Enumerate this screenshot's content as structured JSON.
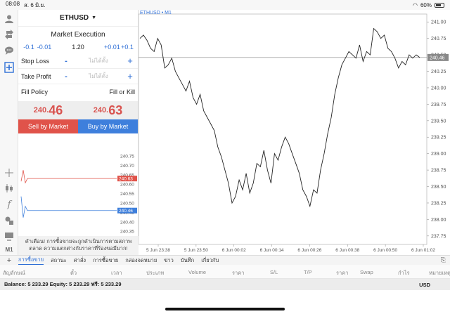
{
  "status_bar": {
    "time": "08:08",
    "date": "ส. 6 มิ.ย.",
    "battery": "60%"
  },
  "order": {
    "symbol": "ETHUSD",
    "title": "Market Execution",
    "volume_steps": [
      "-0.1",
      "-0.01",
      "+0.01",
      "+0.1"
    ],
    "volume": "1.20",
    "stop_loss_label": "Stop Loss",
    "take_profit_label": "Take Profit",
    "not_set": "ไม่ได้ตั้ง",
    "minus": "-",
    "plus": "+",
    "fill_policy_label": "Fill Policy",
    "fill_policy_value": "Fill or Kill",
    "bid_small": "240.",
    "bid_large": "46",
    "ask_small": "240.",
    "ask_large": "63",
    "sell_label": "Sell by Market",
    "buy_label": "Buy by Market",
    "mini_ticks": [
      "240.75",
      "240.70",
      "240.65",
      "240.60",
      "240.55",
      "240.50",
      "240.45",
      "240.40",
      "240.35"
    ],
    "mini_ask_tag": "240.63",
    "mini_bid_tag": "240.46",
    "warning": "คำเตือน! การซื้อขายจะถูกดำเนินการตามสภาพตลาด ความแตกต่างกับราคาที่ร้องขอมีมาก!"
  },
  "rail": {
    "m1_label": "M1"
  },
  "chart_data": {
    "type": "line",
    "title": "ETHUSD • M1",
    "ylim": [
      237.62,
      241.12
    ],
    "yticks": [
      "241.00",
      "240.75",
      "240.50",
      "240.25",
      "240.00",
      "239.75",
      "239.50",
      "239.25",
      "239.00",
      "238.75",
      "238.50",
      "238.25",
      "238.00",
      "237.75"
    ],
    "current_price": "240.46",
    "current_value": 240.46,
    "x_labels": [
      "5 Jun 23:38",
      "5 Jun 23:50",
      "6 Jun 00:02",
      "6 Jun 00:14",
      "6 Jun 00:26",
      "6 Jun 00:38",
      "6 Jun 00:50",
      "6 Jun 01:02"
    ],
    "values": [
      240.75,
      240.8,
      240.72,
      240.6,
      240.55,
      240.75,
      240.65,
      240.3,
      240.35,
      240.45,
      240.25,
      240.15,
      240.05,
      239.95,
      240.1,
      239.85,
      239.75,
      239.9,
      239.65,
      239.55,
      239.45,
      239.35,
      239.1,
      238.95,
      238.75,
      238.55,
      238.25,
      238.35,
      238.6,
      238.45,
      238.7,
      238.4,
      238.55,
      238.85,
      238.8,
      239.05,
      238.75,
      238.55,
      239.0,
      238.9,
      239.1,
      239.25,
      239.15,
      239.0,
      238.85,
      238.7,
      238.45,
      238.35,
      238.2,
      238.45,
      238.4,
      238.75,
      239.0,
      239.3,
      239.55,
      239.9,
      240.15,
      240.35,
      240.45,
      240.55,
      240.5,
      240.45,
      240.65,
      240.4,
      240.55,
      240.5,
      240.9,
      240.85,
      240.75,
      240.8,
      240.6,
      240.55,
      240.45,
      240.3,
      240.4,
      240.35,
      240.5,
      240.45,
      240.5,
      240.46
    ]
  },
  "tabs": {
    "items": [
      "การซื้อขาย",
      "สถานะ",
      "ค่าสั่ง",
      "การซื้อขาย",
      "กล่องจดหมาย",
      "ข่าว",
      "บันทึก",
      "เกี่ยวกับ"
    ],
    "active_index": 0
  },
  "columns": [
    "สัญลักษณ์",
    "ตั๋ว",
    "เวลา",
    "ประเภท",
    "Volume",
    "ราคา",
    "S/L",
    "T/P",
    "ราคา",
    "Swap",
    "กำไร",
    "หมายเหตุ"
  ],
  "balance": {
    "text": "Balance: 5 233.29 Equity: 5 233.29 ฟรี: 5 233.29",
    "currency": "USD"
  }
}
